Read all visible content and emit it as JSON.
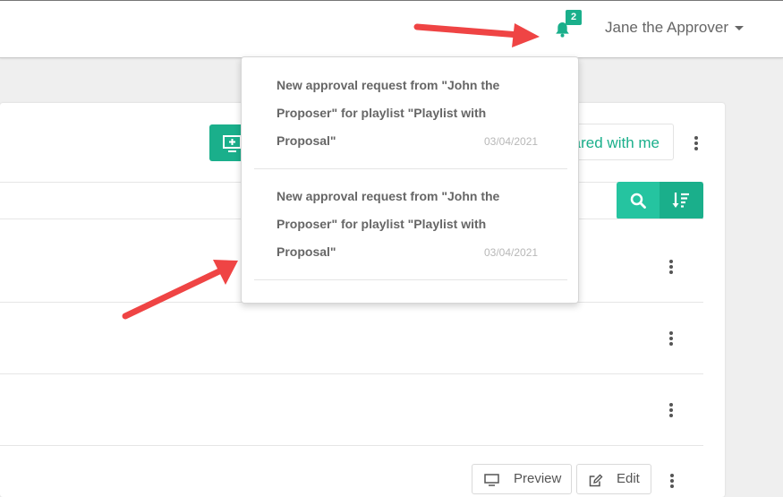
{
  "header": {
    "notifications_count": "2",
    "user_name": "Jane the Approver"
  },
  "toolbar": {
    "shared_tab_label": "Shared with me"
  },
  "row": {
    "preview_label": "Preview",
    "edit_label": "Edit"
  },
  "notifications": [
    {
      "text": "New approval request from \"John the Proposer\" for playlist \"Playlist with Proposal\"",
      "date": "03/04/2021"
    },
    {
      "text": "New approval request from \"John the Proposer\" for playlist \"Playlist with Proposal\"",
      "date": "03/04/2021"
    }
  ],
  "colors": {
    "accent": "#1aaf8b",
    "accent_light": "#25c4a0",
    "annotation_arrow": "#ef4444"
  }
}
